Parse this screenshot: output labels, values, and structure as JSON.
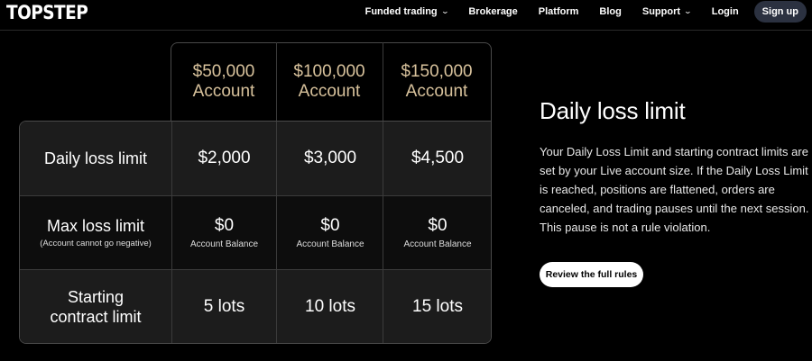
{
  "nav": {
    "logo": "TOPSTEP",
    "links": [
      {
        "label": "Funded trading",
        "has_dropdown": true
      },
      {
        "label": "Brokerage",
        "has_dropdown": false
      },
      {
        "label": "Platform",
        "has_dropdown": false
      },
      {
        "label": "Blog",
        "has_dropdown": false
      },
      {
        "label": "Support",
        "has_dropdown": true
      },
      {
        "label": "Login",
        "has_dropdown": false
      }
    ],
    "signup_label": "Sign up"
  },
  "table": {
    "columns": [
      {
        "line1": "$50,000",
        "line2": "Account"
      },
      {
        "line1": "$100,000",
        "line2": "Account"
      },
      {
        "line1": "$150,000",
        "line2": "Account"
      }
    ],
    "rows": [
      {
        "label": "Daily loss limit",
        "sub": "",
        "values": [
          "$2,000",
          "$3,000",
          "$4,500"
        ],
        "value_subs": [
          "",
          "",
          ""
        ]
      },
      {
        "label": "Max loss limit",
        "sub": "(Account cannot go negative)",
        "values": [
          "$0",
          "$0",
          "$0"
        ],
        "value_subs": [
          "Account Balance",
          "Account Balance",
          "Account Balance"
        ]
      },
      {
        "label": "Starting contract limit",
        "label_line1": "Starting",
        "label_line2": "contract limit",
        "sub": "",
        "values": [
          "5 lots",
          "10 lots",
          "15 lots"
        ],
        "value_subs": [
          "",
          "",
          ""
        ]
      }
    ]
  },
  "info": {
    "title": "Daily loss limit",
    "body": "Your Daily Loss Limit and starting contract limits are set by your Live account size. If the Daily Loss Limit is reached, positions are flattened, orders are canceled, and trading pauses until the next session. This pause is not a rule violation.",
    "button_label": "Review the full rules"
  },
  "colors": {
    "background": "#000000",
    "header_gold": "#d8c29c",
    "row_light": "#1c1c1c",
    "row_dark": "#0d0d0d",
    "signup_bg": "#2b3140"
  },
  "icons": {
    "dropdown": "chevron-down-icon"
  }
}
